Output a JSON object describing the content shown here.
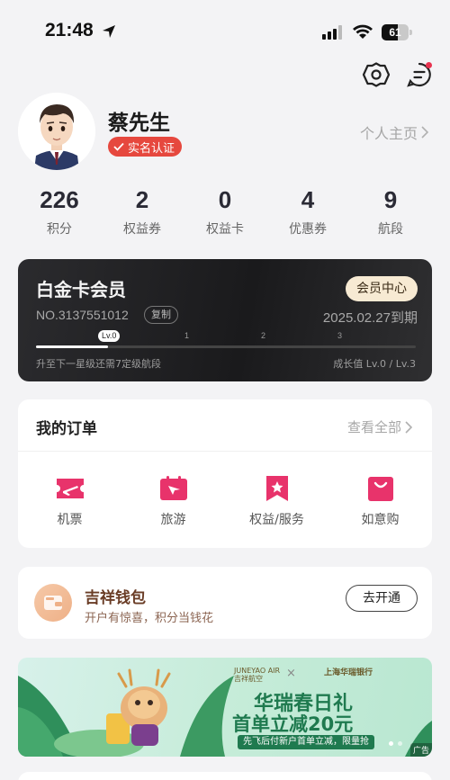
{
  "status_bar": {
    "time": "21:48",
    "battery": "61",
    "battery_level": 0.61,
    "icons": [
      "location-arrow-icon",
      "cellular-signal-icon",
      "wifi-icon",
      "battery-icon"
    ]
  },
  "top_actions": {
    "icons": [
      "gear-icon",
      "message-icon"
    ]
  },
  "profile": {
    "name": "蔡先生",
    "verify_badge": "实名认证",
    "homepage_link": "个人主页"
  },
  "stats": [
    {
      "value": "226",
      "label": "积分"
    },
    {
      "value": "2",
      "label": "权益券"
    },
    {
      "value": "0",
      "label": "权益卡"
    },
    {
      "value": "4",
      "label": "优惠券"
    },
    {
      "value": "9",
      "label": "航段"
    }
  ],
  "member_card": {
    "title": "白金卡会员",
    "center_button": "会员中心",
    "card_no": "NO.3137551012",
    "copy_label": "复制",
    "expiry": "2025.02.27到期",
    "current_level": "Lv.0",
    "level_ticks": [
      "1",
      "2",
      "3"
    ],
    "progress": 0.19,
    "hint": "升至下一星级还需7定级航段",
    "growth": "成长值 Lv.0 / Lv.3"
  },
  "orders": {
    "title": "我的订单",
    "view_all": "查看全部",
    "items": [
      {
        "label": "机票",
        "icon": "flight-ticket-icon"
      },
      {
        "label": "旅游",
        "icon": "travel-icon"
      },
      {
        "label": "权益/服务",
        "icon": "star-bookmark-icon"
      },
      {
        "label": "如意购",
        "icon": "shopping-bag-icon"
      }
    ]
  },
  "wallet": {
    "title": "吉祥钱包",
    "subtitle": "开户有惊喜，积分当钱花",
    "button": "去开通",
    "icon": "wallet-icon"
  },
  "banner": {
    "brand1_line1": "JUNEYAO AIR",
    "brand1_line2": "吉祥航空",
    "separator": "×",
    "brand2": "上海华瑞银行",
    "headline": "华瑞春日礼",
    "offer": "首单立减20元",
    "tag": "先飞后付新户首单立减，限量抢",
    "ad_label": "广告"
  },
  "colors": {
    "accent_red": "#e6483e",
    "order_icon_pink": "#e8336b",
    "card_dark": "#1f1f21",
    "card_gold": "#f7ead3",
    "banner_green": "#1f7a4f"
  }
}
